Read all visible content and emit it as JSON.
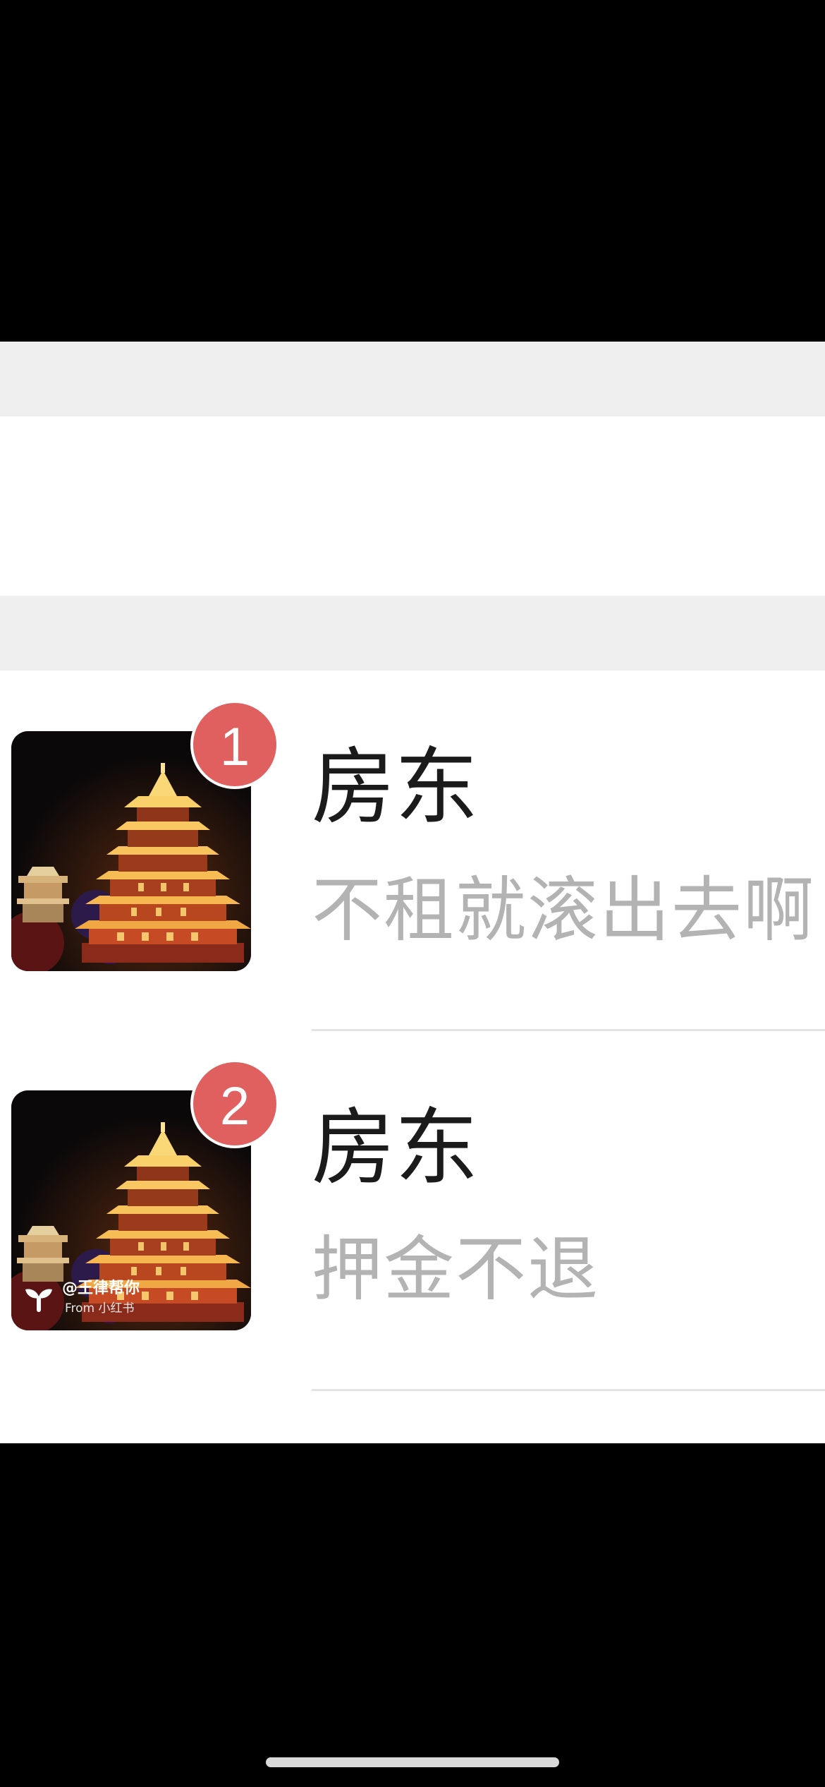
{
  "chats": [
    {
      "badge": "1",
      "title": "房东",
      "preview": "不租就滚出去啊",
      "avatar": {
        "icon": "yellow-crane-tower-night-image",
        "watermark": null
      }
    },
    {
      "badge": "2",
      "title": "房东",
      "preview": "押金不退",
      "avatar": {
        "icon": "yellow-crane-tower-night-image",
        "watermark": {
          "author": "@王律帮你",
          "source": "From 小红书"
        }
      }
    }
  ],
  "colors": {
    "badge": "#e0605f",
    "title": "#1b1b1b",
    "preview": "#b3b3b3",
    "band": "#efefef",
    "background": "#ffffff"
  }
}
